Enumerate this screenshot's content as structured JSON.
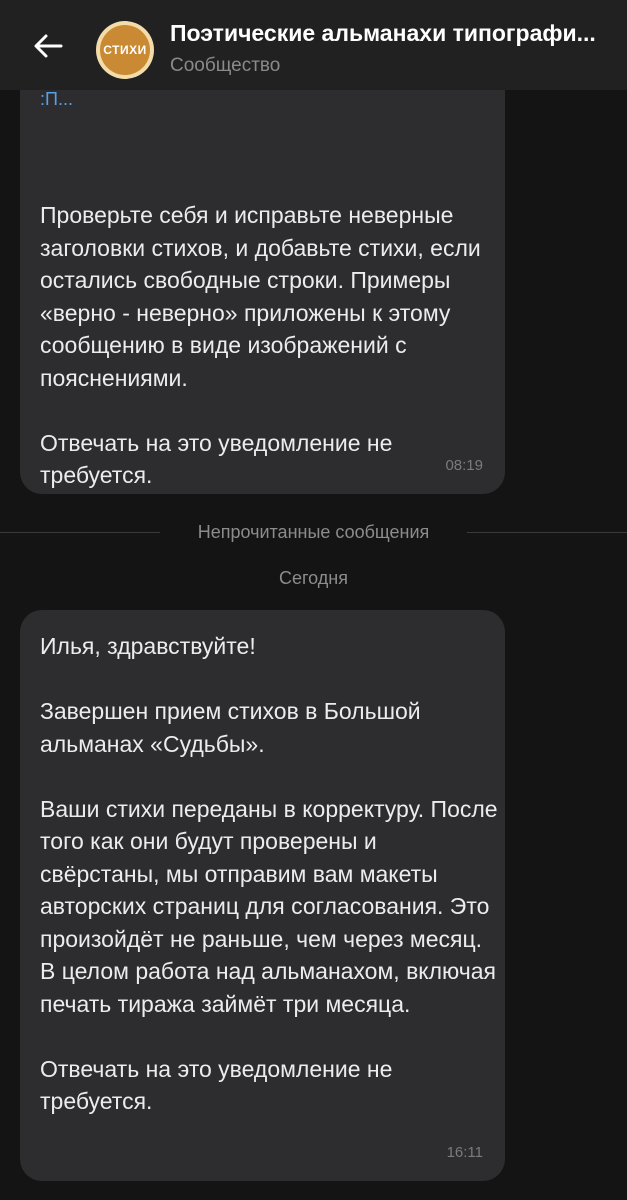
{
  "header": {
    "title": "Поэтические альманахи типографи...",
    "subtitle": "Сообщество",
    "avatar_text": "СТИХИ",
    "back_icon": "arrow-left-icon"
  },
  "messages": [
    {
      "truncated_link": ":П...",
      "paragraphs": [
        "Проверьте себя и исправьте неверные заголовки стихов, и добавьте стихи, если остались свободные строки. Примеры «верно - неверно» приложены к этому сообщению в виде изображений с пояснениями.",
        "Отвечать на это уведомление не требуется."
      ],
      "time": "08:19"
    },
    {
      "paragraphs": [
        "Илья, здравствуйте!",
        "Завершен прием стихов в Большой альманах «Судьбы».",
        "Ваши стихи переданы в корректуру. После того как они будут проверены и свёрстаны, мы отправим вам макеты авторских страниц для согласования. Это произойдёт не раньше, чем через месяц. В целом работа над альманахом, включая печать тиража займёт три месяца.",
        "Отвечать на это уведомление не требуется."
      ],
      "time": "16:11"
    }
  ],
  "separators": {
    "unread": "Непрочитанные сообщения",
    "date": "Сегодня"
  },
  "colors": {
    "background": "#141414",
    "header": "#212121",
    "bubble": "#2d2d2f",
    "avatar": "#c98a33",
    "link": "#5aa0e6"
  }
}
